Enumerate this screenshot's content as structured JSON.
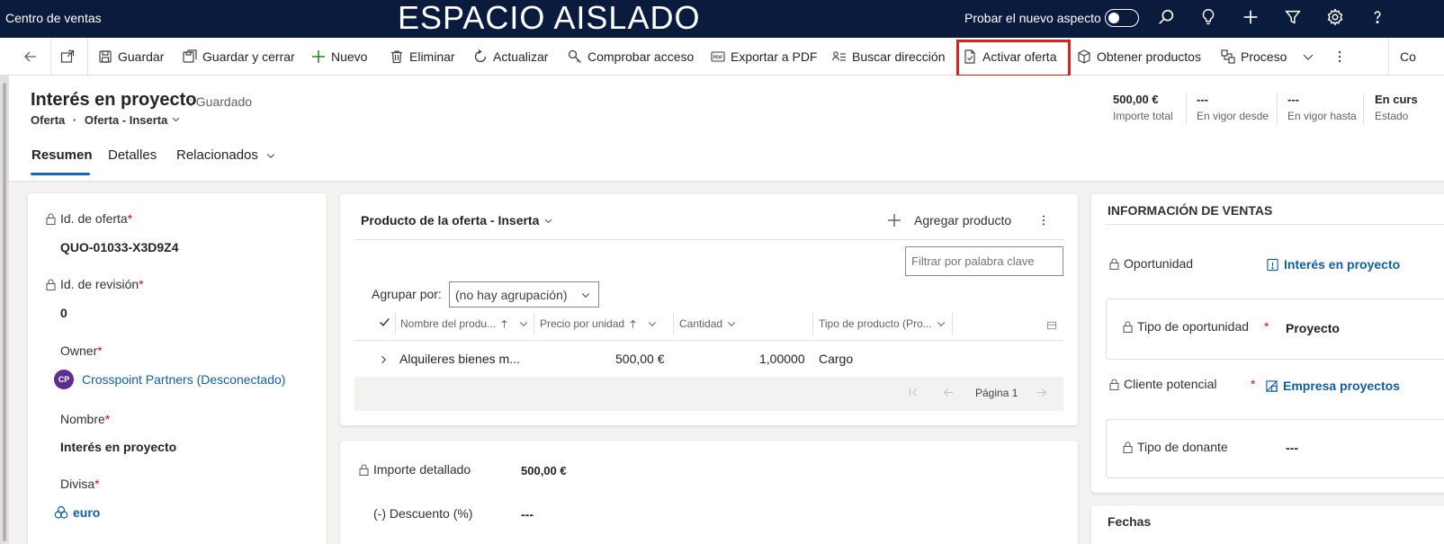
{
  "topbar": {
    "app_title": "Centro de ventas",
    "environment": "ESPACIO AISLADO",
    "try_new_look": "Probar el nuevo aspecto",
    "icons": [
      "search-icon",
      "lightbulb-icon",
      "plus-icon",
      "filter-icon",
      "gear-icon",
      "help-icon"
    ]
  },
  "commands": {
    "save": "Guardar",
    "save_close": "Guardar y cerrar",
    "new": "Nuevo",
    "delete": "Eliminar",
    "refresh": "Actualizar",
    "check_access": "Comprobar acceso",
    "export_pdf": "Exportar a PDF",
    "find_address": "Buscar dirección",
    "activate_quote": "Activar oferta",
    "get_products": "Obtener productos",
    "process": "Proceso",
    "overflow_cut": "Co"
  },
  "header": {
    "title": "Interés en proyecto",
    "status_suffix": ": Guardado",
    "entity": "Oferta",
    "form": "Oferta - Inserta",
    "kpis": [
      {
        "value": "500,00 €",
        "label": "Importe total"
      },
      {
        "value": "---",
        "label": "En vigor desde"
      },
      {
        "value": "---",
        "label": "En vigor hasta"
      },
      {
        "value": "En curs",
        "label": "Estado"
      }
    ]
  },
  "tabs": [
    "Resumen",
    "Detalles",
    "Relacionados"
  ],
  "left_panel": {
    "quote_id_label": "Id. de oferta",
    "quote_id": "QUO-01033-X3D9Z4",
    "revision_label": "Id. de revisión",
    "revision": "0",
    "owner_label": "Owner",
    "owner_initials": "CP",
    "owner": "Crosspoint Partners (Desconectado)",
    "name_label": "Nombre",
    "name": "Interés en proyecto",
    "currency_label": "Divisa",
    "currency": "euro",
    "required_mark": "*"
  },
  "products": {
    "title": "Producto de la oferta - Inserta",
    "add_product": "Agregar producto",
    "filter_placeholder": "Filtrar por palabra clave",
    "group_by_label": "Agrupar por:",
    "group_by_value": "(no hay agrupación)",
    "columns": [
      "Nombre del produ...",
      "Precio por unidad",
      "Cantidad",
      "Tipo de producto (Pro..."
    ],
    "rows": [
      {
        "name": "Alquileres bienes m...",
        "price": "500,00 €",
        "qty": "1,00000",
        "type": "Cargo"
      }
    ],
    "page": "Página 1"
  },
  "amounts": {
    "detailed_label": "Importe detallado",
    "detailed": "500,00 €",
    "discount_label": "(-) Descuento (%)",
    "discount": "---"
  },
  "sales_info": {
    "heading": "INFORMACIÓN DE VENTAS",
    "opportunity_label": "Oportunidad",
    "opportunity": "Interés en proyecto",
    "opp_type_label": "Tipo de oportunidad",
    "opp_type": "Proyecto",
    "prospect_label": "Cliente potencial",
    "prospect": "Empresa proyectos",
    "donor_type_label": "Tipo de donante",
    "donor_type": "---",
    "dates_heading": "Fechas"
  }
}
